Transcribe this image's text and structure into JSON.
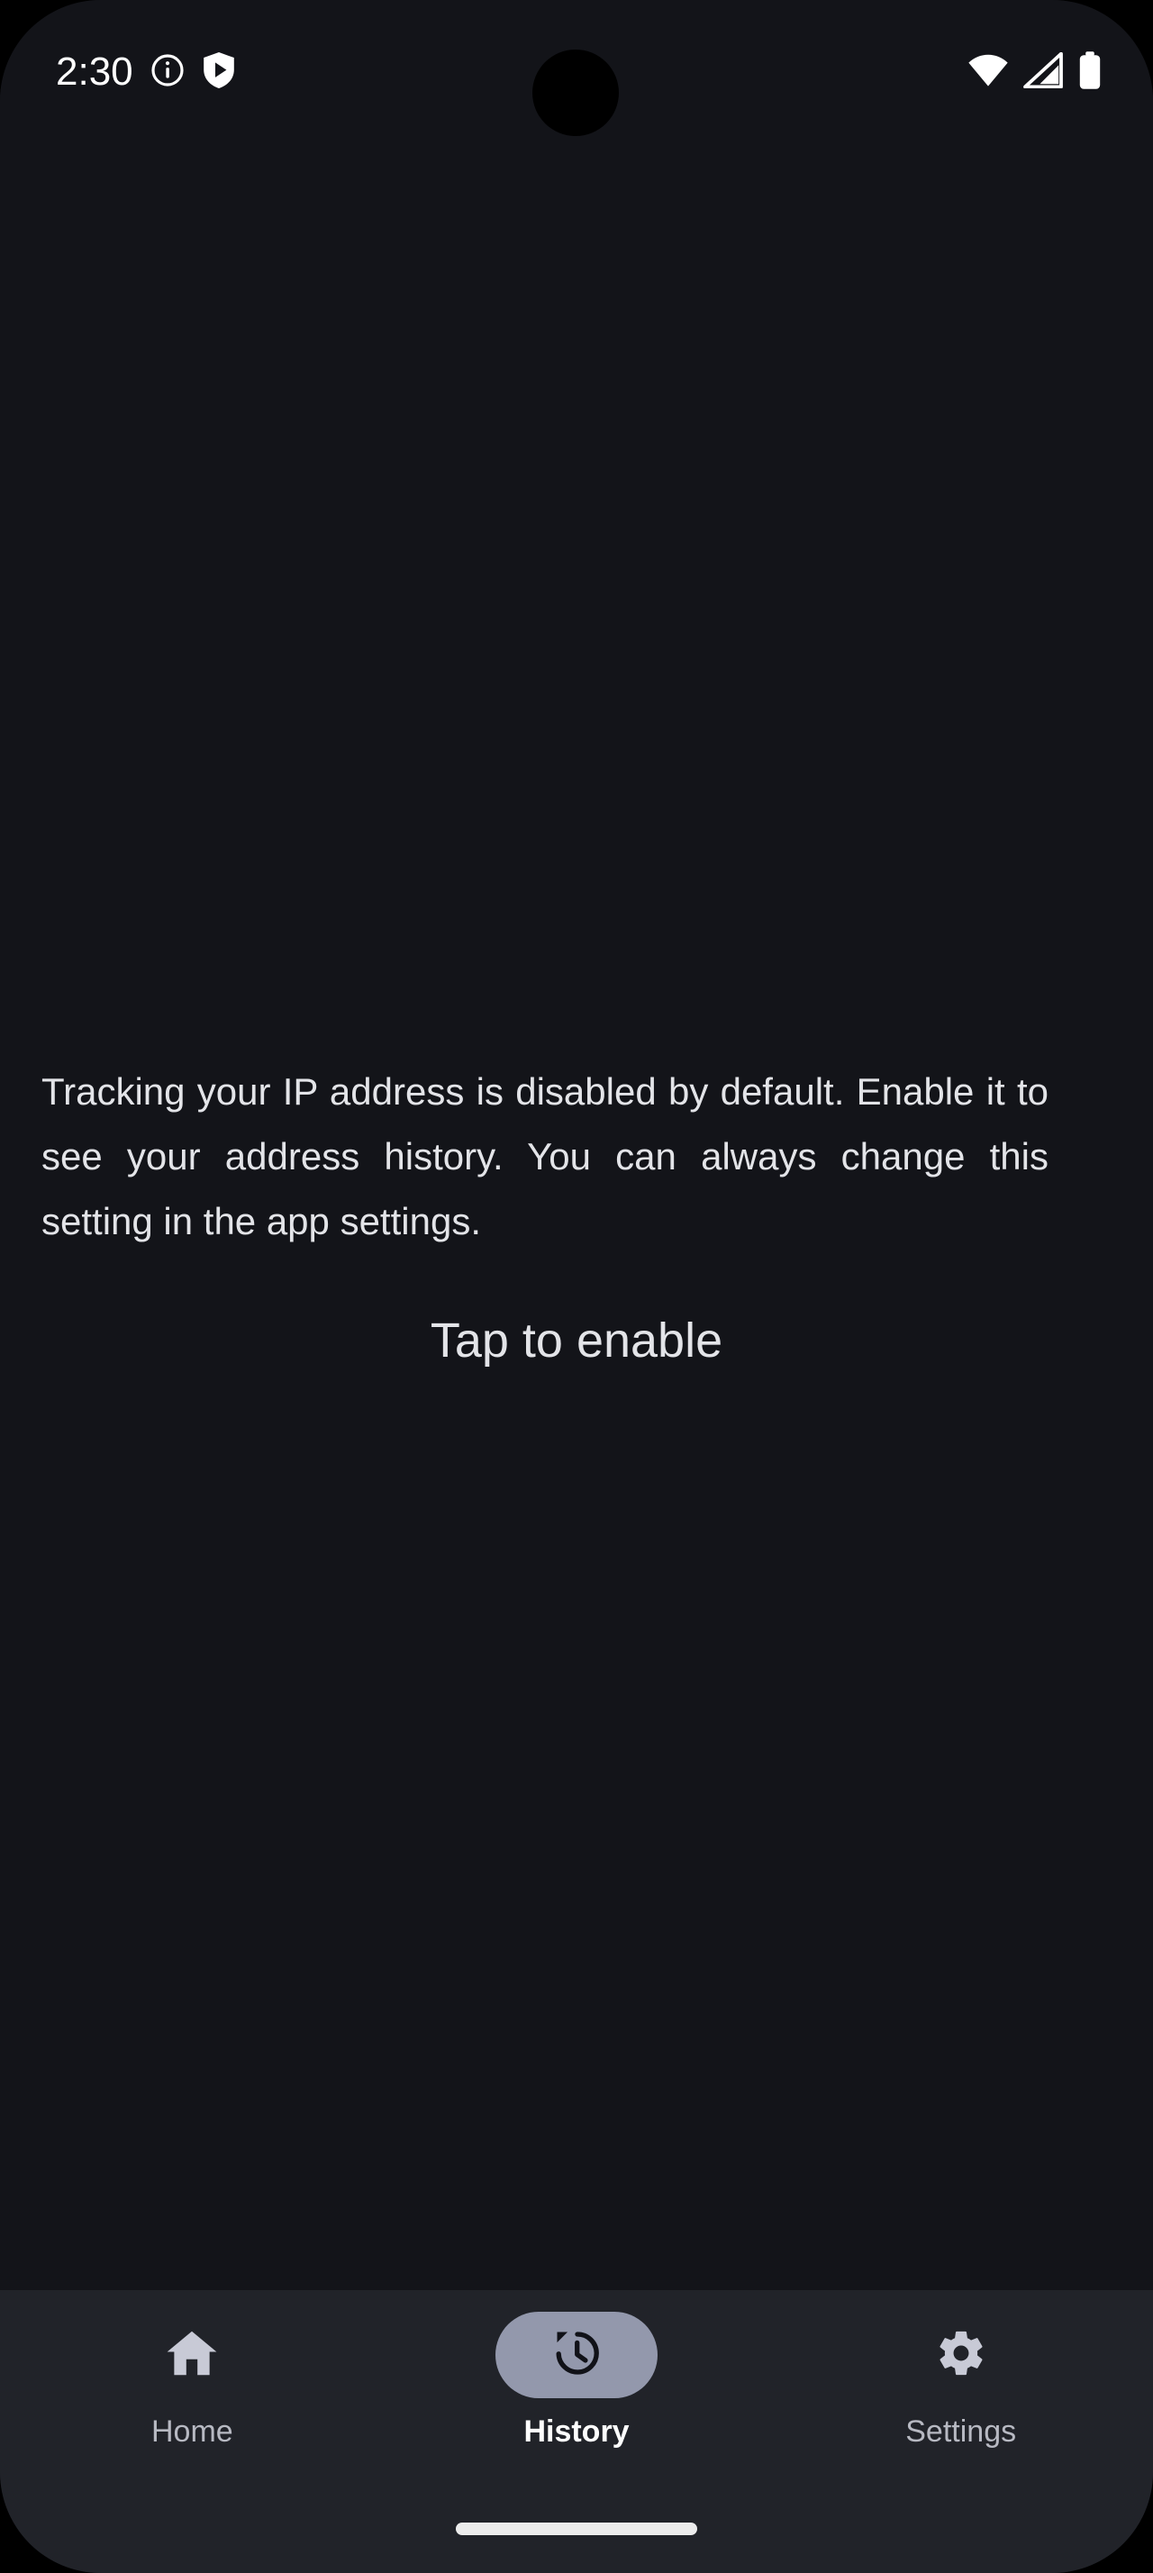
{
  "status_bar": {
    "clock": "2:30",
    "left_icons": [
      {
        "name": "info-icon",
        "glyph": "info-circle"
      },
      {
        "name": "play-protect-shield-icon",
        "glyph": "shield-play"
      }
    ],
    "right_icons": [
      {
        "name": "wifi-icon",
        "glyph": "wifi-full"
      },
      {
        "name": "cellular-signal-icon",
        "glyph": "signal-triangle"
      },
      {
        "name": "battery-icon",
        "glyph": "battery-full"
      }
    ]
  },
  "screen": {
    "title": "History",
    "empty_state": {
      "message": "Tracking your IP address is disabled by default. Enable it to see your address history. You can always change this setting in the app settings.",
      "action_label": "Tap to enable"
    }
  },
  "bottom_nav": {
    "active_index": 1,
    "items": [
      {
        "label": "Home",
        "icon": "home-icon",
        "active": false
      },
      {
        "label": "History",
        "icon": "history-clock-icon",
        "active": true
      },
      {
        "label": "Settings",
        "icon": "gear-icon",
        "active": false
      }
    ]
  },
  "colors": {
    "screen_background": "#131419",
    "nav_background": "#212329",
    "active_pill": "#9398AC",
    "active_label": "#FFFFFF",
    "inactive_icon": "#C8CAD6",
    "inactive_label": "#B7B9C2",
    "body_text": "#E3E4E8",
    "home_indicator": "#ECECEC"
  }
}
